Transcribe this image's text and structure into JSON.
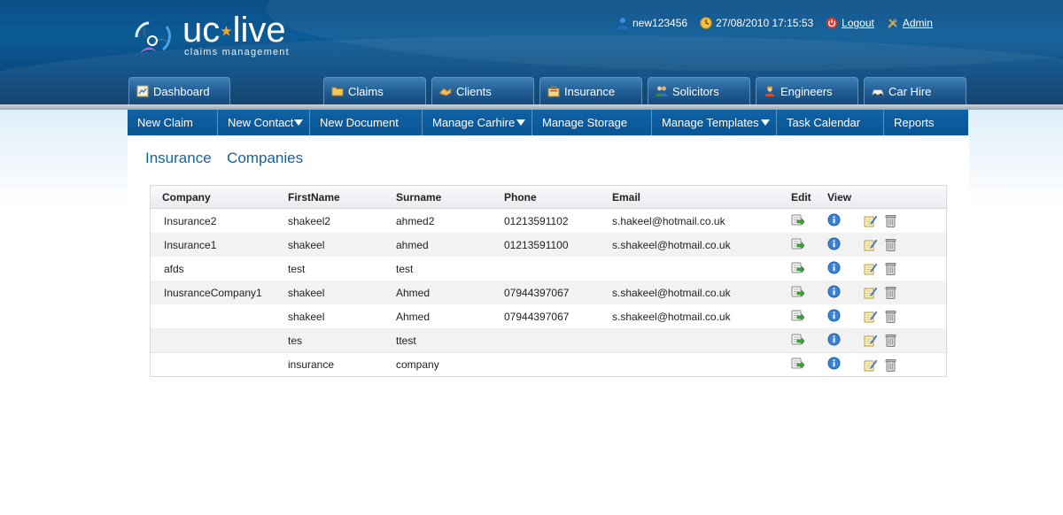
{
  "brand": {
    "name_left": "uc",
    "name_right": "live",
    "tagline": "claims management"
  },
  "topbar": {
    "username": "new123456",
    "datetime": "27/08/2010 17:15:53",
    "logout_label": "Logout",
    "admin_label": "Admin"
  },
  "tabs": [
    {
      "label": "Dashboard"
    },
    {
      "label": "Claims"
    },
    {
      "label": "Clients"
    },
    {
      "label": "Insurance"
    },
    {
      "label": "Solicitors"
    },
    {
      "label": "Engineers"
    },
    {
      "label": "Car Hire"
    }
  ],
  "submenu": [
    {
      "label": "New Claim"
    },
    {
      "label": "New Contact"
    },
    {
      "label": "New Document"
    },
    {
      "label": "Manage Carhire"
    },
    {
      "label": "Manage Storage"
    },
    {
      "label": "Manage Templates"
    },
    {
      "label": "Task Calendar"
    },
    {
      "label": "Reports"
    }
  ],
  "page": {
    "title": "Insurance  Companies"
  },
  "table": {
    "headers": {
      "company": "Company",
      "first": "FirstName",
      "surname": "Surname",
      "phone": "Phone",
      "email": "Email",
      "edit": "Edit",
      "view": "View"
    },
    "rows": [
      {
        "company": "Insurance2",
        "first": "shakeel2",
        "surname": "ahmed2",
        "phone": "01213591102",
        "email": "s.hakeel@hotmail.co.uk"
      },
      {
        "company": "Insurance1",
        "first": "shakeel",
        "surname": "ahmed",
        "phone": "01213591100",
        "email": "s.shakeel@hotmail.co.uk"
      },
      {
        "company": "afds",
        "first": "test",
        "surname": "test",
        "phone": "",
        "email": ""
      },
      {
        "company": "InusranceCompany1",
        "first": "shakeel",
        "surname": "Ahmed",
        "phone": "07944397067",
        "email": "s.shakeel@hotmail.co.uk"
      },
      {
        "company": "",
        "first": "shakeel",
        "surname": "Ahmed",
        "phone": "07944397067",
        "email": "s.shakeel@hotmail.co.uk"
      },
      {
        "company": "",
        "first": "tes",
        "surname": "ttest",
        "phone": "",
        "email": ""
      },
      {
        "company": "",
        "first": "insurance",
        "surname": "company",
        "phone": "",
        "email": ""
      }
    ]
  }
}
